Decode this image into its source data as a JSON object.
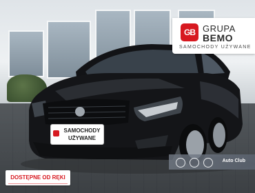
{
  "logo": {
    "mark": "GB",
    "word1": "GRUPA",
    "word2": "BEMO",
    "tagline": "SAMOCHODY UŻYWANE"
  },
  "plate": {
    "line1": "SAMOCHODY",
    "line2": "UŻYWANE"
  },
  "strip": {
    "label": "Auto Club"
  },
  "availability": {
    "label": "DOSTĘPNE OD RĘKI"
  },
  "colors": {
    "brand_red": "#d71920",
    "car_body": "#141518"
  }
}
